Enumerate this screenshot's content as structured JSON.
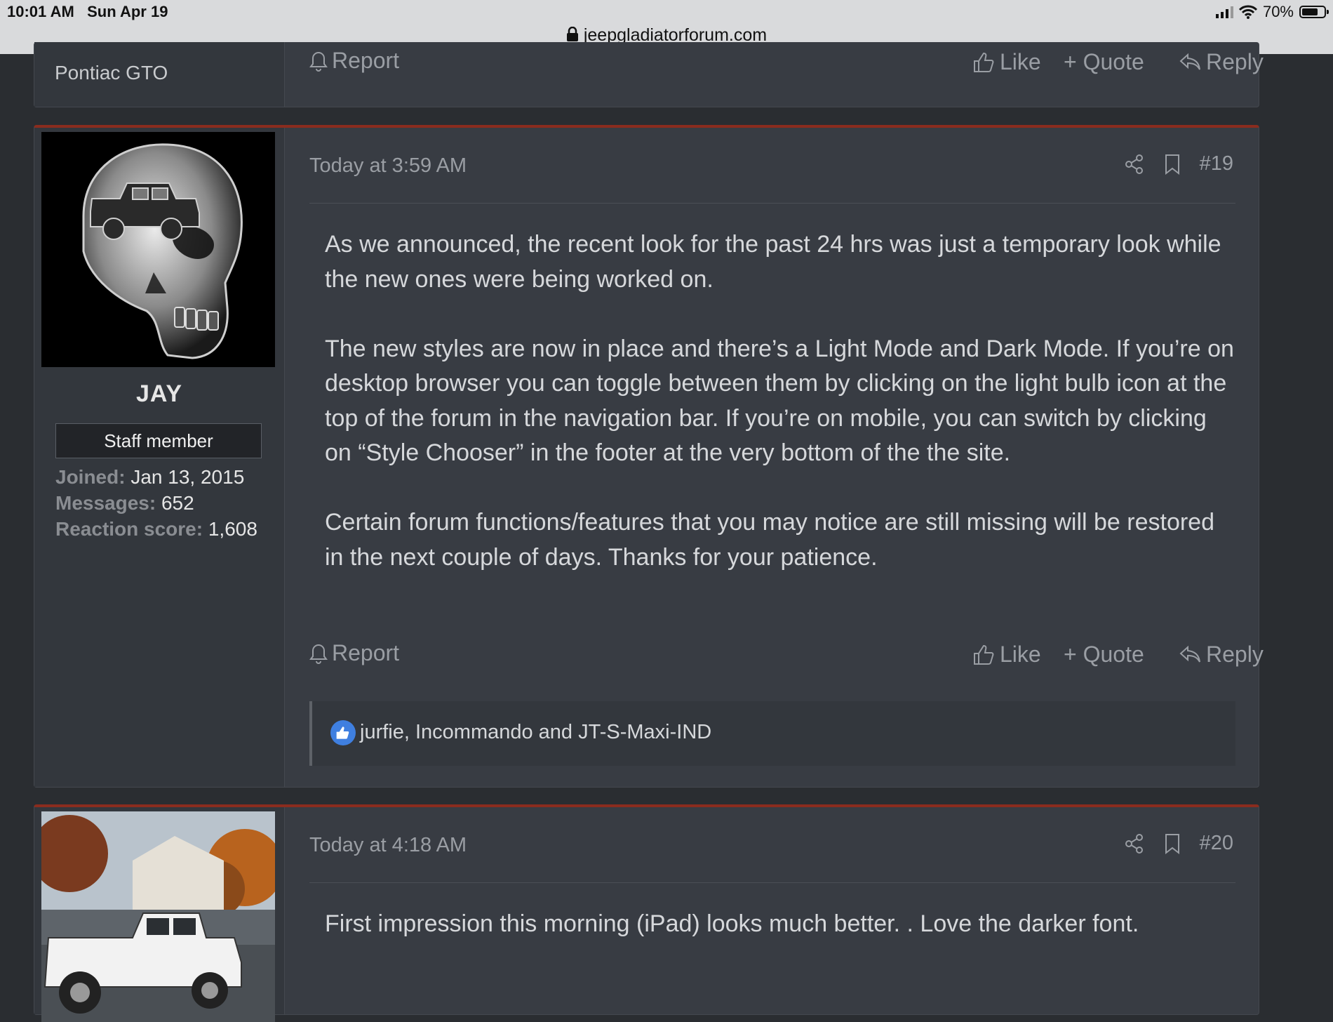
{
  "status_bar": {
    "time": "10:01 AM",
    "date": "Sun Apr 19",
    "url": "jeepgladiatorforum.com",
    "battery": "70%"
  },
  "prev_post": {
    "user_sig": "Pontiac GTO",
    "report": "Report",
    "like": "Like",
    "quote": "+ Quote",
    "reply": "Reply"
  },
  "post19": {
    "username": "JAY",
    "badge": "Staff member",
    "joined_label": "Joined:",
    "joined": "Jan 13, 2015",
    "messages_label": "Messages:",
    "messages": "652",
    "reaction_label": "Reaction score:",
    "reaction": "1,608",
    "time": "Today at 3:59 AM",
    "number": "#19",
    "paragraphs": [
      "As we announced, the recent look for the past 24 hrs was just a temporary look while the new ones were being worked on.",
      "The new styles are now in place and there’s a Light Mode and Dark Mode. If you’re on desktop browser you can toggle between them by clicking on the light bulb icon at the top of the forum in the navigation bar. If you’re on mobile, you can switch by clicking on “Style Chooser” in the footer at the very bottom of the the site.",
      "Certain forum functions/features that you may notice are still missing will be restored in the next couple of days. Thanks for your patience."
    ],
    "report": "Report",
    "like": "Like",
    "quote": "+ Quote",
    "reply": "Reply",
    "reactions": "jurfie, Incommando and JT-S-Maxi-IND"
  },
  "post20": {
    "time": "Today at 4:18 AM",
    "number": "#20",
    "text": "First impression this morning (iPad) looks much better. . Love the darker font."
  }
}
